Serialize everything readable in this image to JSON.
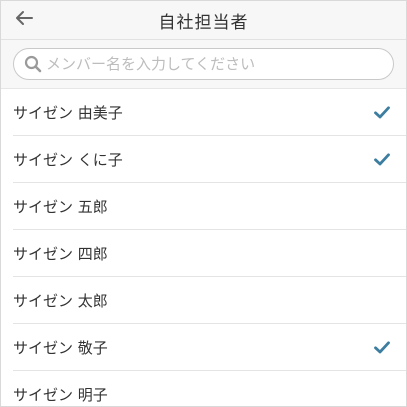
{
  "header": {
    "title": "自社担当者",
    "back_icon": "arrow-left-icon"
  },
  "search": {
    "placeholder": "メンバー名を入力してください",
    "value": "",
    "icon": "search-icon"
  },
  "colors": {
    "check": "#3d7ea0",
    "header_bg": "#f7f7f7",
    "divider": "#e4e4e4"
  },
  "members": [
    {
      "name": "サイゼン 由美子",
      "selected": true
    },
    {
      "name": "サイゼン くに子",
      "selected": true
    },
    {
      "name": "サイゼン 五郎",
      "selected": false
    },
    {
      "name": "サイゼン 四郎",
      "selected": false
    },
    {
      "name": "サイゼン 太郎",
      "selected": false
    },
    {
      "name": "サイゼン 敬子",
      "selected": true
    },
    {
      "name": "サイゼン 明子",
      "selected": false
    }
  ]
}
